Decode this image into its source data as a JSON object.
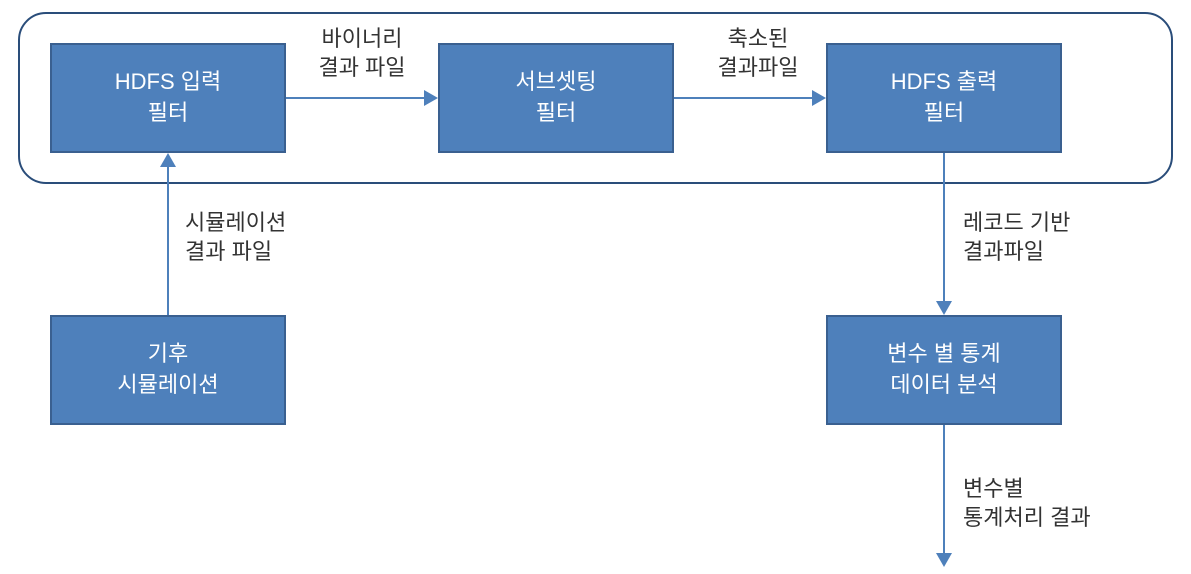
{
  "boxes": {
    "hdfs_input": {
      "line1": "HDFS 입력",
      "line2": "필터"
    },
    "subsetting": {
      "line1": "서브셋팅",
      "line2": "필터"
    },
    "hdfs_output": {
      "line1": "HDFS 출력",
      "line2": "필터"
    },
    "climate_sim": {
      "line1": "기후",
      "line2": "시뮬레이션"
    },
    "stat_analysis": {
      "line1": "변수 별 통계",
      "line2": "데이터 분석"
    }
  },
  "labels": {
    "binary_result": {
      "line1": "바이너리",
      "line2": "결과 파일"
    },
    "reduced_result": {
      "line1": "축소된",
      "line2": "결과파일"
    },
    "sim_result": {
      "line1": "시뮬레이션",
      "line2": "결과 파일"
    },
    "record_result": {
      "line1": "레코드 기반",
      "line2": "결과파일"
    },
    "stat_result": {
      "line1": "변수별",
      "line2": "통계처리 결과"
    }
  }
}
